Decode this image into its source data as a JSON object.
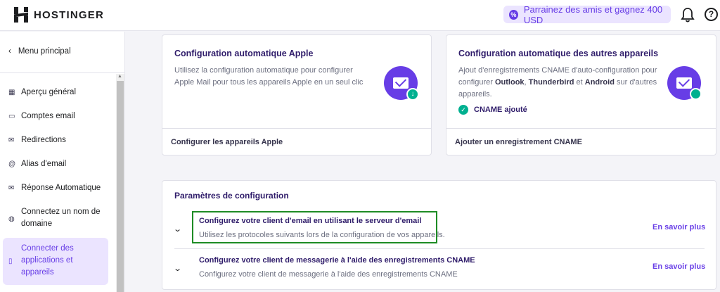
{
  "header": {
    "brand": "HOSTINGER",
    "referral_label": "Parrainez des amis et gagnez 400 USD",
    "help_glyph": "?"
  },
  "sidebar": {
    "back_label": "Menu principal",
    "items": [
      {
        "label": "Aperçu général",
        "icon": "grid-icon"
      },
      {
        "label": "Comptes email",
        "icon": "inbox-icon"
      },
      {
        "label": "Redirections",
        "icon": "forward-mail-icon"
      },
      {
        "label": "Alias d'email",
        "icon": "at-icon"
      },
      {
        "label": "Réponse Automatique",
        "icon": "auto-reply-icon"
      },
      {
        "label": "Connectez un nom de domaine",
        "icon": "globe-link-icon"
      },
      {
        "label": "Connecter des applications et appareils",
        "icon": "device-icon",
        "active": true
      }
    ]
  },
  "apple_card": {
    "title": "Configuration automatique Apple",
    "description": "Utilisez la configuration automatique pour configurer Apple Mail pour tous les appareils Apple en un seul clic",
    "link": "Configurer les appareils Apple"
  },
  "other_card": {
    "title": "Configuration automatique des autres appareils",
    "description_prefix": "Ajout d'enregistrements CNAME d'auto-configuration pour configurer ",
    "description_bold_1": "Outlook",
    "description_sep_1": ", ",
    "description_bold_2": "Thunderbird",
    "description_sep_2": " et ",
    "description_bold_3": "Android",
    "description_suffix": " sur d'autres appareils.",
    "status": "CNAME ajouté",
    "link": "Ajouter un enregistrement CNAME"
  },
  "config": {
    "title": "Paramètres de configuration",
    "rows": [
      {
        "title": "Configurez votre client d'email en utilisant le serveur d'email",
        "description": "Utilisez les protocoles suivants lors de la configuration de vos appareils.",
        "link": "En savoir plus"
      },
      {
        "title": "Configurez votre client de messagerie à l'aide des enregistrements CNAME",
        "description": "Configurez votre client de messagerie à l'aide des enregistrements CNAME",
        "link": "En savoir plus"
      }
    ]
  },
  "colors": {
    "accent": "#673de6",
    "accent_light": "#ebe4ff",
    "success": "#00b090",
    "highlight_box": "#1e8c25"
  }
}
